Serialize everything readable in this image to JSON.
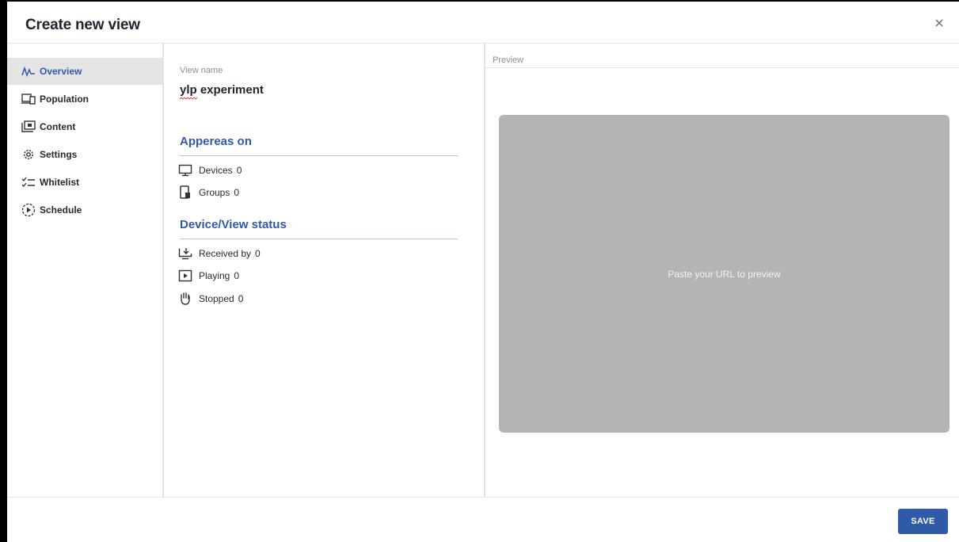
{
  "dialog": {
    "title": "Create new view",
    "close_icon": "close-icon"
  },
  "sidebar": {
    "items": [
      {
        "label": "Overview",
        "icon": "activity-icon",
        "active": true
      },
      {
        "label": "Population",
        "icon": "devices-icon",
        "active": false
      },
      {
        "label": "Content",
        "icon": "content-folder-icon",
        "active": false
      },
      {
        "label": "Settings",
        "icon": "gear-icon",
        "active": false
      },
      {
        "label": "Whitelist",
        "icon": "checklist-icon",
        "active": false
      },
      {
        "label": "Schedule",
        "icon": "schedule-play-icon",
        "active": false
      }
    ]
  },
  "overview": {
    "view_name_label": "View name",
    "view_name_value": "ylp experiment",
    "appears_on": {
      "title": "Appereas on",
      "devices_label": "Devices",
      "devices_count": "0",
      "groups_label": "Groups",
      "groups_count": "0"
    },
    "status": {
      "title": "Device/View status",
      "received_label": "Received by",
      "received_count": "0",
      "playing_label": "Playing",
      "playing_count": "0",
      "stopped_label": "Stopped",
      "stopped_count": "0"
    }
  },
  "preview": {
    "label": "Preview",
    "placeholder": "Paste your URL to preview"
  },
  "footer": {
    "save_label": "SAVE"
  },
  "colors": {
    "accent": "#2f5aa8",
    "preview_bg": "#b4b4b4",
    "active_nav_bg": "#e4e4e4"
  }
}
